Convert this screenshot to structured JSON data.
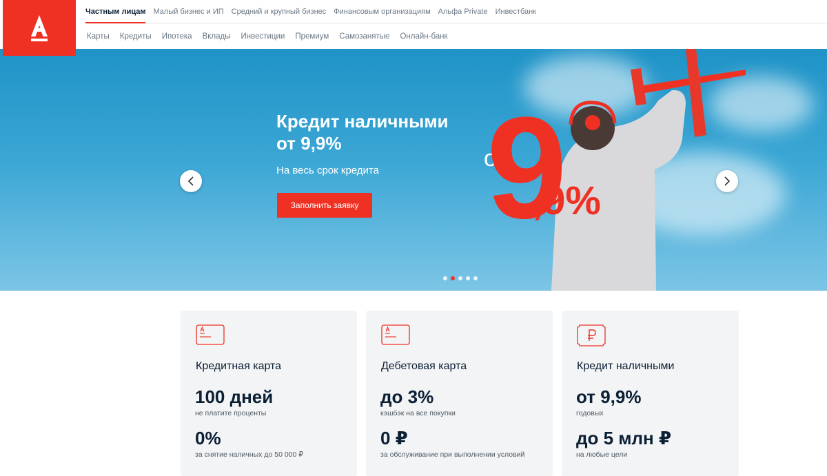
{
  "brand": {
    "logo_letter": "А",
    "accent": "#ef3124"
  },
  "topnav": [
    {
      "label": "Частным лицам",
      "active": true
    },
    {
      "label": "Малый бизнес и ИП"
    },
    {
      "label": "Средний и крупный бизнес"
    },
    {
      "label": "Финансовым организациям"
    },
    {
      "label": "Альфа Private"
    },
    {
      "label": "Инвестбанк"
    }
  ],
  "subnav": [
    {
      "label": "Карты"
    },
    {
      "label": "Кредиты"
    },
    {
      "label": "Ипотека"
    },
    {
      "label": "Вклады"
    },
    {
      "label": "Инвестиции"
    },
    {
      "label": "Премиум"
    },
    {
      "label": "Самозанятые"
    },
    {
      "label": "Онлайн-банк"
    }
  ],
  "hero": {
    "title_line1": "Кредит наличными",
    "title_line2": "от 9,9%",
    "subtitle": "На весь срок кредита",
    "button": "Заполнить заявку",
    "promo_prefix": "от",
    "promo_big": "9",
    "promo_small": ",9%",
    "slides_total": 5,
    "slide_active": 2,
    "prev_icon": "chevron-left-icon",
    "next_icon": "chevron-right-icon"
  },
  "cards": [
    {
      "icon": "credit-card-icon",
      "title": "Кредитная карта",
      "big1": "100 дней",
      "small1": "не платите проценты",
      "big2": "0%",
      "small2": "за снятие наличных до 50 000 ₽"
    },
    {
      "icon": "debit-card-icon",
      "title": "Дебетовая карта",
      "big1": "до 3%",
      "small1": "кэшбэк на все покупки",
      "big2": "0 ₽",
      "small2": "за обслуживание при выполнении условий"
    },
    {
      "icon": "ruble-banknote-icon",
      "title": "Кредит наличными",
      "big1": "от 9,9%",
      "small1": "годовых",
      "big2": "до 5 млн ₽",
      "small2": "на любые цели"
    }
  ]
}
